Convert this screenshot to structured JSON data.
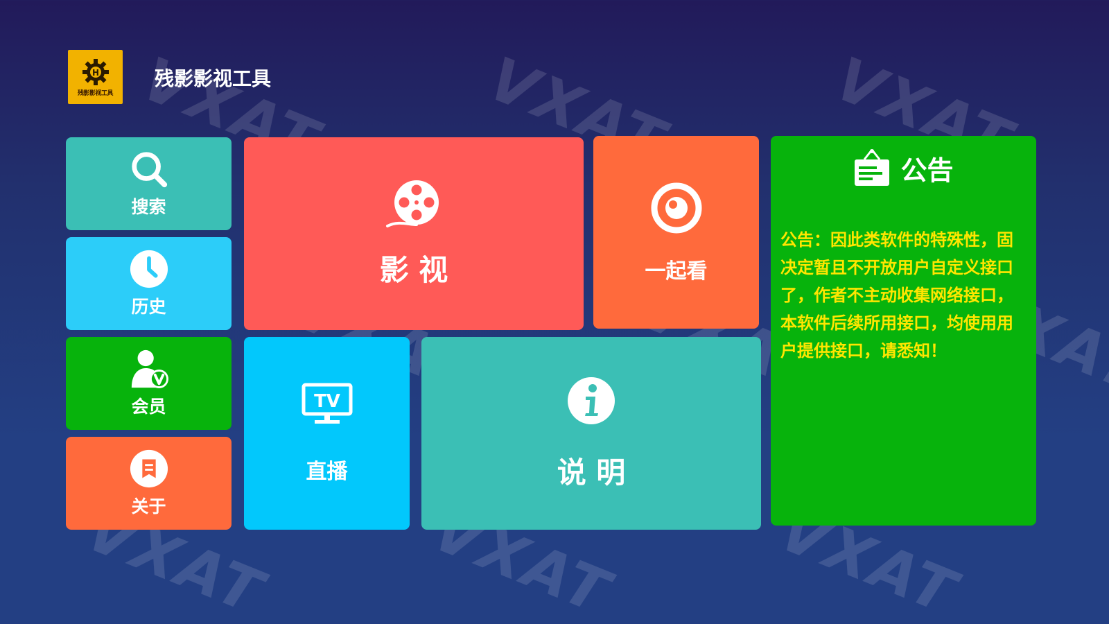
{
  "app": {
    "title": "残影影视工具",
    "logo_text": "残影影视工具"
  },
  "watermark": "VXAT",
  "tiles": {
    "search": {
      "label": "搜索",
      "icon": "search-icon",
      "color": "#3bbfb5"
    },
    "history": {
      "label": "历史",
      "icon": "clock-icon",
      "color": "#2ccdf9"
    },
    "member": {
      "label": "会员",
      "icon": "vip-user-icon",
      "color": "#07b30c"
    },
    "about": {
      "label": "关于",
      "icon": "about-icon",
      "color": "#ff6a3c"
    },
    "movies": {
      "label": "影 视",
      "icon": "film-reel-icon",
      "color": "#ff5a57"
    },
    "watch_together": {
      "label": "一起看",
      "icon": "eye-icon",
      "color": "#ff6a3c"
    },
    "live": {
      "label": "直播",
      "icon": "tv-icon",
      "color": "#02c8fc"
    },
    "instructions": {
      "label": "说 明",
      "icon": "info-icon",
      "color": "#3bbfb5"
    }
  },
  "notice": {
    "title": "公告",
    "icon": "notice-board-icon",
    "color": "#07b30c",
    "text_color": "#ffe600",
    "body": "公告：因此类软件的特殊性，固决定暂且不开放用户自定义接口了，作者不主动收集网络接口，本软件后续所用接口，均使用用户提供接口，请悉知！"
  }
}
